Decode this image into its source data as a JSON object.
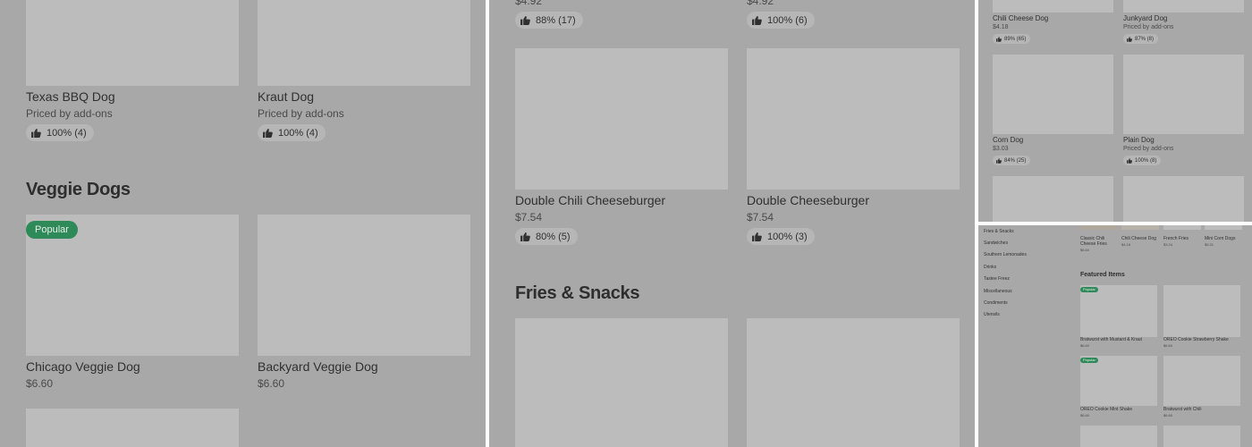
{
  "panel1": {
    "top_items": [
      {
        "name": "Texas BBQ Dog",
        "price": "Priced by add-ons",
        "rating": "100% (4)"
      },
      {
        "name": "Kraut Dog",
        "price": "Priced by add-ons",
        "rating": "100% (4)"
      }
    ],
    "section_title": "Veggie Dogs",
    "badge": "Popular",
    "items": [
      {
        "name": "Chicago Veggie Dog",
        "price": "$6.60"
      },
      {
        "name": "Backyard Veggie Dog",
        "price": "$6.60"
      }
    ]
  },
  "panel2": {
    "top_items": [
      {
        "price": "$4.92",
        "rating": "88% (17)"
      },
      {
        "price": "$4.92",
        "rating": "100% (6)"
      }
    ],
    "items": [
      {
        "name": "Double Chili Cheeseburger",
        "price": "$7.54",
        "rating": "80% (5)"
      },
      {
        "name": "Double Cheeseburger",
        "price": "$7.54",
        "rating": "100% (3)"
      }
    ],
    "section_title": "Fries & Snacks"
  },
  "panel3": {
    "top_items": [
      {
        "name": "Chili Cheese Dog",
        "price": "$4.18",
        "rating": "89% (65)"
      },
      {
        "name": "Junkyard Dog",
        "price": "Priced by add-ons",
        "rating": "87% (8)"
      }
    ],
    "items": [
      {
        "name": "Corn Dog",
        "price": "$3.03",
        "rating": "84% (25)"
      },
      {
        "name": "Plain Dog",
        "price": "Priced by add-ons",
        "rating": "100% (8)"
      }
    ]
  },
  "panel4": {
    "sidebar": [
      "Fries & Snacks",
      "Sandwiches",
      "Southern Lemonades",
      "Drinks",
      "Tastee Freez",
      "Miscellaneous",
      "Condiments",
      "Utensils"
    ],
    "top_row": [
      {
        "name": "Classic Chili Cheese Fries",
        "price": "$6.60"
      },
      {
        "name": "Chili Cheese Dog",
        "price": "$4.18"
      },
      {
        "name": "French Fries",
        "price": "$3.24"
      },
      {
        "name": "Mini Corn Dogs",
        "price": "$5.31"
      }
    ],
    "section_title": "Featured Items",
    "badge": "Popular",
    "featured": [
      {
        "name": "Bratwurst with Mustard & Kraut",
        "price": "$6.60"
      },
      {
        "name": "OREO Cookie Strawberry Shake",
        "price": "$6.60"
      },
      {
        "name": "OREO Cookie Mint Shake",
        "price": "$6.60"
      },
      {
        "name": "Bratwurst with Chili",
        "price": "$6.60"
      }
    ]
  },
  "colors": {
    "overlay": "#a8a8a8",
    "image_placeholder": "#bcbcbc",
    "badge_green": "#2f8a5a"
  },
  "icons": {
    "rating": "thumbs-up-icon"
  }
}
